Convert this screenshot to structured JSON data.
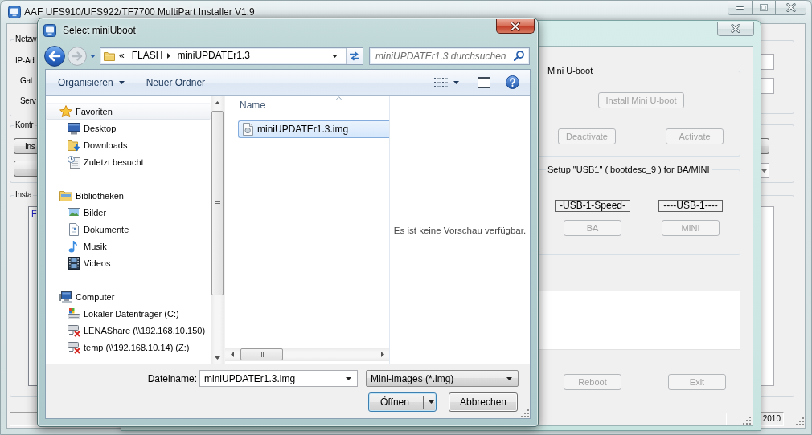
{
  "installer_window": {
    "title": "AAF UFS910/UFS922/TF7700 MultiPart Installer V1.9",
    "left_groups": [
      {
        "label": "Netzw",
        "kind": "fields",
        "fields": [
          "IP-Ad",
          "Gat",
          "Serv"
        ]
      },
      {
        "label": "Kontr",
        "kind": "buttons",
        "buttons": [
          {
            "kind": "labelled",
            "label": "Ins"
          },
          {
            "kind": "blank"
          }
        ]
      },
      {
        "label": "Insta",
        "kind": "list",
        "items": [
          "F"
        ]
      }
    ],
    "status_bar": {
      "text": "2010"
    }
  },
  "control_panel": {
    "mini_uboot": {
      "label": "Mini U-boot",
      "install_button": {
        "label": "Install Mini U-boot",
        "disabled": true
      },
      "buttons": [
        {
          "label": "Deactivate",
          "disabled": true
        },
        {
          "label": "Activate",
          "disabled": true
        }
      ]
    },
    "usb_setup": {
      "label": "Setup \"USB1\" ( bootdesc_9 ) for BA/MINI",
      "columns": [
        {
          "indicator": "-USB-1-Speed-",
          "button": {
            "label": "BA",
            "disabled": true
          }
        },
        {
          "indicator": "----USB-1----",
          "button": {
            "label": "MINI",
            "disabled": true
          }
        }
      ]
    },
    "buttons": [
      {
        "label": "Reboot",
        "disabled": true
      },
      {
        "label": "Exit",
        "disabled": true
      }
    ]
  },
  "file_dialog": {
    "title": "Select miniUboot",
    "address": {
      "overflow": "«",
      "path": [
        "FLASH",
        "miniUPDATEr1.3"
      ]
    },
    "search": {
      "placeholder": "miniUPDATEr1.3 durchsuchen"
    },
    "toolbar": [
      {
        "label": "Organisieren",
        "dropdown": true
      },
      {
        "label": "Neuer Ordner",
        "dropdown": false
      }
    ],
    "navigation": [
      {
        "label": "Favoriten",
        "kind": "favorites",
        "selected": true,
        "children": [
          {
            "label": "Desktop",
            "kind": "desktop",
            "selected": false
          },
          {
            "label": "Downloads",
            "kind": "downloads",
            "selected": false
          },
          {
            "label": "Zuletzt besucht",
            "kind": "recent",
            "selected": false
          }
        ]
      },
      {
        "label": "Bibliotheken",
        "kind": "libraries",
        "selected": false,
        "children": [
          {
            "label": "Bilder",
            "kind": "pictures",
            "selected": false
          },
          {
            "label": "Dokumente",
            "kind": "documents",
            "selected": false
          },
          {
            "label": "Musik",
            "kind": "music",
            "selected": false
          },
          {
            "label": "Videos",
            "kind": "videos",
            "selected": false
          }
        ]
      },
      {
        "label": "Computer",
        "kind": "computer",
        "selected": false,
        "children": [
          {
            "label": "Lokaler Datenträger (C:)",
            "kind": "drive",
            "selected": false
          },
          {
            "label": "LENAShare (\\\\192.168.10.150)",
            "kind": "network",
            "selected": false
          },
          {
            "label": "temp (\\\\192.168.10.14) (Z:)",
            "kind": "network",
            "selected": false
          }
        ]
      }
    ],
    "file_list": {
      "columns": [
        {
          "label": "Name",
          "sorted": true
        }
      ],
      "files": [
        {
          "name": "miniUPDATEr1.3.img",
          "selected": true
        }
      ]
    },
    "preview": {
      "message": "Es ist keine Vorschau verfügbar."
    },
    "file_name": {
      "label": "Dateiname:",
      "value": "miniUPDATEr1.3.img"
    },
    "file_type": {
      "value": "Mini-images (*.img)"
    },
    "buttons": [
      {
        "label": "Öffnen",
        "kind": "split",
        "default": true
      },
      {
        "label": "Abbrechen",
        "kind": "plain",
        "default": false
      }
    ]
  }
}
